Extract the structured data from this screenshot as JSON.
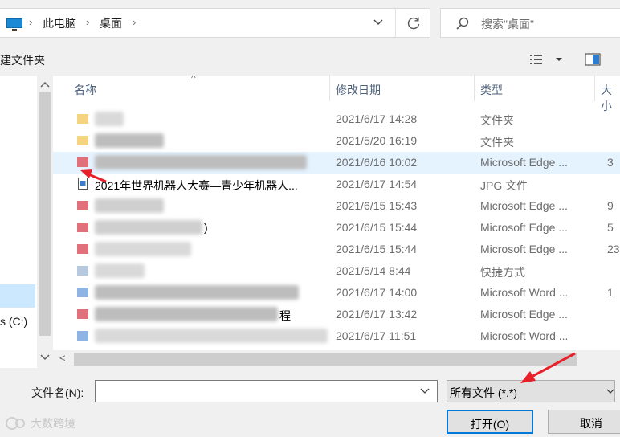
{
  "address": {
    "crumbs": [
      "此电脑",
      "桌面"
    ],
    "search_placeholder": "搜索\"桌面\""
  },
  "toolbar": {
    "new_folder": "建文件夹"
  },
  "nav": {
    "drive_label": "s (C:)"
  },
  "columns": {
    "name": "名称",
    "date": "修改日期",
    "type": "类型",
    "size": "大小"
  },
  "files": [
    {
      "name": "",
      "date": "2021/6/17 14:28",
      "type": "文件夹",
      "size": "",
      "icon": "folder-icon"
    },
    {
      "name": "",
      "date": "2021/5/20 16:19",
      "type": "文件夹",
      "size": "",
      "icon": "folder-icon"
    },
    {
      "name": "",
      "date": "2021/6/16 10:02",
      "type": "Microsoft Edge ...",
      "size": "3",
      "icon": "pdf-icon"
    },
    {
      "name": "2021年世界机器人大赛—青少年机器人...",
      "date": "2021/6/17 14:54",
      "type": "JPG 文件",
      "size": "",
      "icon": "jpg-icon"
    },
    {
      "name": "",
      "date": "2021/6/15 15:43",
      "type": "Microsoft Edge ...",
      "size": "9",
      "icon": "pdf-icon"
    },
    {
      "name": ")",
      "date": "2021/6/15 15:44",
      "type": "Microsoft Edge ...",
      "size": "5",
      "icon": "pdf-icon"
    },
    {
      "name": "",
      "date": "2021/6/15 15:44",
      "type": "Microsoft Edge ...",
      "size": "23",
      "icon": "pdf-icon"
    },
    {
      "name": "",
      "date": "2021/5/14 8:44",
      "type": "快捷方式",
      "size": "",
      "icon": "shortcut-icon"
    },
    {
      "name": "",
      "date": "2021/6/17 14:00",
      "type": "Microsoft Word ...",
      "size": "1",
      "icon": "word-icon"
    },
    {
      "name": "程",
      "date": "2021/6/17 13:42",
      "type": "Microsoft Edge ...",
      "size": "",
      "icon": "pdf-icon"
    },
    {
      "name": "",
      "date": "2021/6/17 11:51",
      "type": "Microsoft Word ...",
      "size": "",
      "icon": "word-icon"
    }
  ],
  "bottom": {
    "filename_label": "文件名(N):",
    "filename_value": "",
    "filetype_value": "所有文件 (*.*)",
    "open_label": "打开(O)",
    "cancel_label": "取消"
  },
  "watermark": "大数跨境",
  "colors": {
    "accent": "#0078d7",
    "selection": "#cce8ff",
    "hover_row": "#e5f3ff",
    "annotation": "#e8202a"
  }
}
